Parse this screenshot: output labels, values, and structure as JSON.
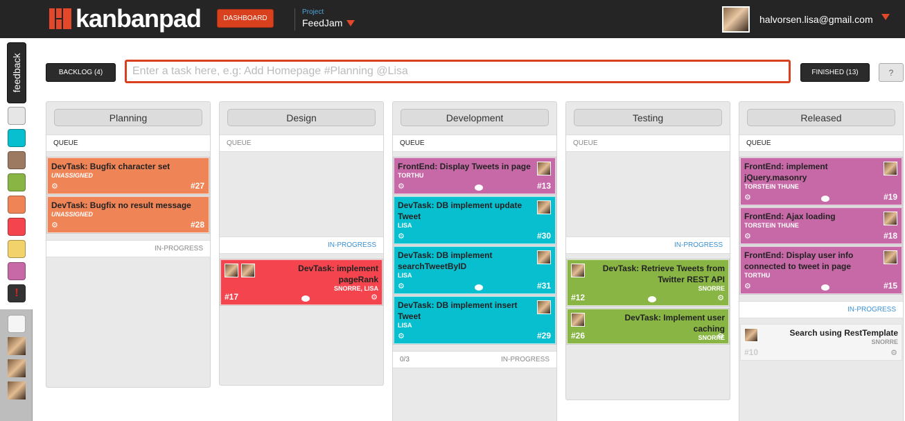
{
  "header": {
    "logo_text": "kanbanpad",
    "dashboard_label": "DASHBOARD",
    "project_label": "Project",
    "project_name": "FeedJam",
    "user_email": "halvorsen.lisa@gmail.com"
  },
  "sidebar": {
    "feedback_label": "feedback",
    "swatches": [
      "#e6e6e6",
      "#08bfd0",
      "#9c7a62",
      "#88b544",
      "#ef8456",
      "#f4454f",
      "#f2d36b",
      "#c769a7",
      "#333333"
    ],
    "alert_glyph": "!"
  },
  "toolbar": {
    "backlog_label": "BACKLOG (4)",
    "task_placeholder": "Enter a task here, e.g: Add Homepage #Planning @Lisa",
    "finished_label": "FINISHED (13)",
    "help_label": "?"
  },
  "columns": [
    {
      "title": "Planning",
      "queue_label": "QUEUE",
      "inprogress_label": "IN-PROGRESS",
      "queue_cards": [
        {
          "title": "DevTask: Bugfix character set",
          "assignee": "UNASSIGNED",
          "number": "#27"
        },
        {
          "title": "DevTask: Bugfix no result message",
          "assignee": "UNASSIGNED",
          "number": "#28"
        }
      ]
    },
    {
      "title": "Design",
      "queue_label": "QUEUE",
      "inprogress_label": "IN-PROGRESS",
      "inprogress_cards": [
        {
          "title": "DevTask: implement pageRank",
          "assignee": "SNORRE, LISA",
          "number": "#17"
        }
      ]
    },
    {
      "title": "Development",
      "queue_label": "QUEUE",
      "inprogress_label": "IN-PROGRESS",
      "inprogress_count": "0/3",
      "queue_cards": [
        {
          "title": "FrontEnd: Display Tweets in page",
          "assignee": "TORTHU",
          "number": "#13"
        },
        {
          "title": "DevTask: DB implement update Tweet",
          "assignee": "LISA",
          "number": "#30"
        },
        {
          "title": "DevTask: DB implement searchTweetByID",
          "assignee": "LISA",
          "number": "#31"
        },
        {
          "title": "DevTask: DB implement insert Tweet",
          "assignee": "LISA",
          "number": "#29"
        }
      ]
    },
    {
      "title": "Testing",
      "queue_label": "QUEUE",
      "inprogress_label": "IN-PROGRESS",
      "inprogress_cards": [
        {
          "title": "DevTask: Retrieve Tweets from Twitter REST API",
          "assignee": "SNORRE",
          "number": "#12"
        },
        {
          "title": "DevTask: Implement user caching",
          "assignee": "SNORRE",
          "number": "#26"
        }
      ]
    },
    {
      "title": "Released",
      "queue_label": "QUEUE",
      "inprogress_label": "IN-PROGRESS",
      "queue_cards": [
        {
          "title": "FrontEnd: implement jQuery.masonry",
          "assignee": "TORSTEIN THUNE",
          "number": "#19"
        },
        {
          "title": "FrontEnd: Ajax loading",
          "assignee": "TORSTEIN THUNE",
          "number": "#18"
        },
        {
          "title": "FrontEnd: Display user info connected to tweet in page",
          "assignee": "TORTHU",
          "number": "#15"
        }
      ],
      "inprogress_cards": [
        {
          "title": "Search using RestTemplate",
          "assignee": "SNORRE",
          "number": "#10"
        }
      ]
    }
  ]
}
